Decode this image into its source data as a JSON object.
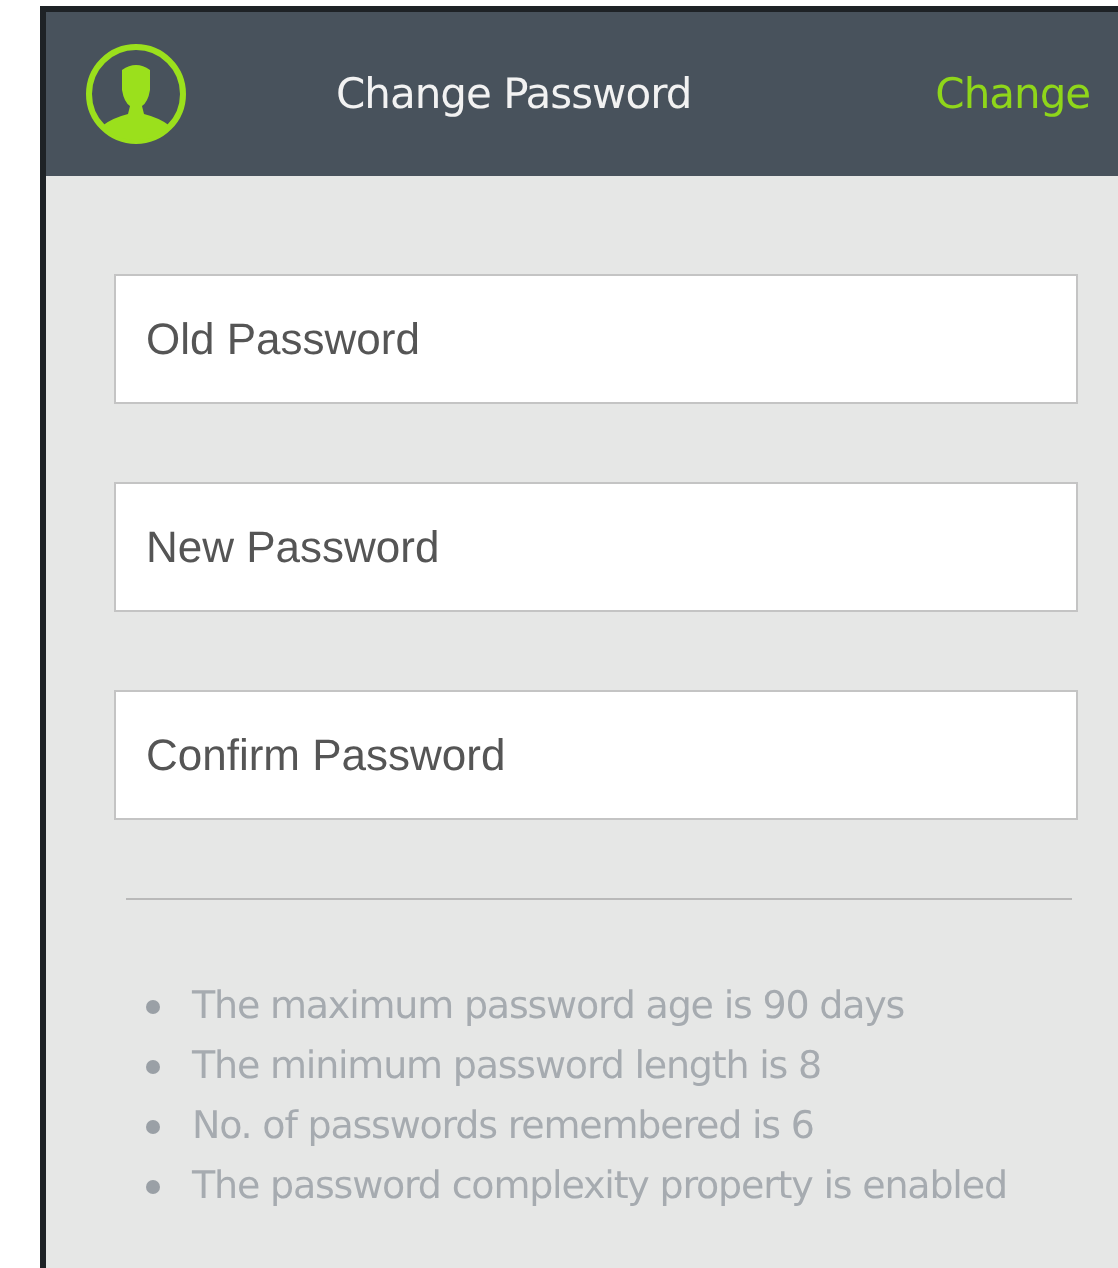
{
  "header": {
    "title": "Change Password",
    "action": "Change"
  },
  "fields": [
    {
      "placeholder": "Old Password"
    },
    {
      "placeholder": "New Password"
    },
    {
      "placeholder": "Confirm Password"
    }
  ],
  "rules": [
    "The maximum password age is 90 days",
    "The minimum password length is 8",
    "No. of passwords remembered is 6",
    "The password complexity property is enabled"
  ]
}
